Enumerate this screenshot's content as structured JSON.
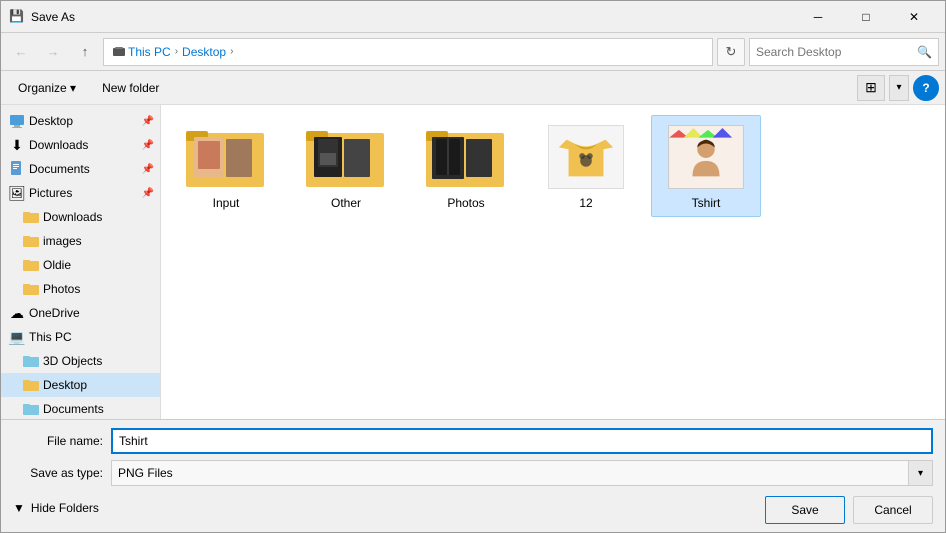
{
  "window": {
    "title": "Save As",
    "icon": "💾"
  },
  "address": {
    "breadcrumbs": [
      "This PC",
      "Desktop"
    ],
    "search_placeholder": "Search Desktop"
  },
  "toolbar": {
    "organize_label": "Organize",
    "new_folder_label": "New folder"
  },
  "sidebar": {
    "items": [
      {
        "id": "desktop",
        "label": "Desktop",
        "icon": "🖥",
        "indent": 0,
        "pin": true,
        "type": "folder"
      },
      {
        "id": "downloads",
        "label": "Downloads",
        "icon": "⬇",
        "indent": 0,
        "pin": true,
        "type": "folder"
      },
      {
        "id": "documents",
        "label": "Documents",
        "icon": "📄",
        "indent": 0,
        "pin": true,
        "type": "folder"
      },
      {
        "id": "pictures",
        "label": "Pictures",
        "icon": "🖼",
        "indent": 0,
        "pin": true,
        "type": "folder"
      },
      {
        "id": "downloads2",
        "label": "Downloads",
        "icon": "📁",
        "indent": 1,
        "type": "folder"
      },
      {
        "id": "images",
        "label": "images",
        "icon": "📁",
        "indent": 1,
        "type": "folder"
      },
      {
        "id": "oldie",
        "label": "Oldie",
        "icon": "📁",
        "indent": 1,
        "type": "folder"
      },
      {
        "id": "photos",
        "label": "Photos",
        "icon": "📁",
        "indent": 1,
        "type": "folder"
      },
      {
        "id": "onedrive",
        "label": "OneDrive",
        "icon": "☁",
        "indent": 0,
        "type": "cloud"
      },
      {
        "id": "thispc",
        "label": "This PC",
        "icon": "💻",
        "indent": 0,
        "type": "pc"
      },
      {
        "id": "3dobjects",
        "label": "3D Objects",
        "icon": "📦",
        "indent": 1,
        "type": "folder"
      },
      {
        "id": "desktop2",
        "label": "Desktop",
        "icon": "🖥",
        "indent": 1,
        "type": "folder",
        "selected": true
      },
      {
        "id": "documents2",
        "label": "Documents",
        "icon": "📄",
        "indent": 1,
        "type": "folder"
      }
    ]
  },
  "files": [
    {
      "id": "input",
      "label": "Input",
      "type": "folder_with_image",
      "color": "#f0c050"
    },
    {
      "id": "other",
      "label": "Other",
      "type": "folder_with_image2",
      "color": "#f0c050"
    },
    {
      "id": "photos",
      "label": "Photos",
      "type": "folder_dark",
      "color": "#f0c050"
    },
    {
      "id": "12",
      "label": "12",
      "type": "image_tshirt_yellow"
    },
    {
      "id": "tshirt",
      "label": "Tshirt",
      "type": "image_child",
      "selected": true
    }
  ],
  "bottom": {
    "file_name_label": "File name:",
    "file_name_value": "Tshirt",
    "save_as_label": "Save as type:",
    "save_as_value": "PNG Files",
    "save_label": "Save",
    "cancel_label": "Cancel",
    "hide_folders_label": "Hide Folders"
  }
}
